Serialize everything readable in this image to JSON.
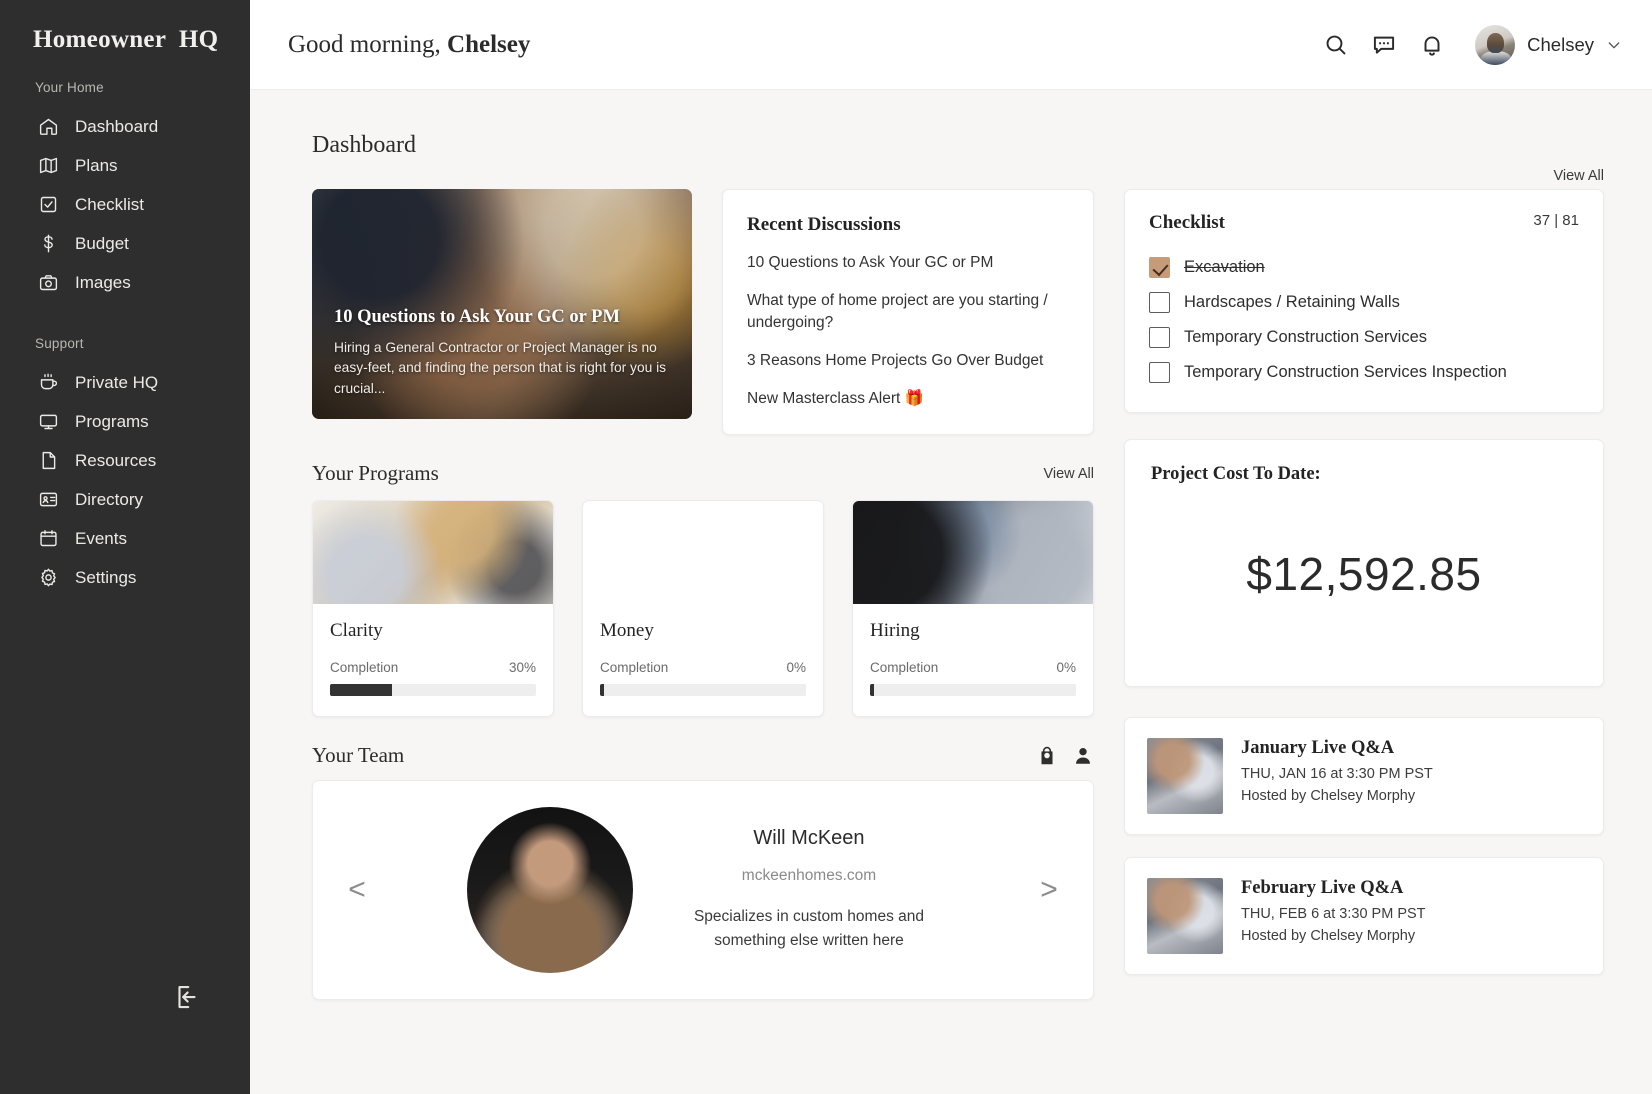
{
  "sidebar": {
    "brand": "Homeowner  HQ",
    "groups": [
      {
        "label": "Your Home",
        "items": [
          {
            "label": "Dashboard",
            "icon": "home-icon"
          },
          {
            "label": "Plans",
            "icon": "map-icon"
          },
          {
            "label": "Checklist",
            "icon": "checkbox-icon"
          },
          {
            "label": "Budget",
            "icon": "dollar-icon"
          },
          {
            "label": "Images",
            "icon": "camera-icon"
          }
        ]
      },
      {
        "label": "Support",
        "items": [
          {
            "label": "Private HQ",
            "icon": "coffee-icon"
          },
          {
            "label": "Programs",
            "icon": "monitor-icon"
          },
          {
            "label": "Resources",
            "icon": "file-icon"
          },
          {
            "label": "Directory",
            "icon": "contact-card-icon"
          },
          {
            "label": "Events",
            "icon": "calendar-icon"
          },
          {
            "label": "Settings",
            "icon": "gear-icon"
          }
        ]
      }
    ],
    "logout_icon": "logout-icon"
  },
  "topbar": {
    "greeting_prefix": "Good morning, ",
    "greeting_name": "Chelsey",
    "user_name": "Chelsey",
    "icons": [
      "search-icon",
      "chat-icon",
      "bell-icon"
    ]
  },
  "page": {
    "title": "Dashboard",
    "view_all": "View All"
  },
  "feature": {
    "title": "10 Questions to Ask Your GC or PM",
    "description": "Hiring a General Contractor or Project Manager is no easy-feet, and finding the person that is right for you is crucial..."
  },
  "discussions": {
    "title": "Recent Discussions",
    "items": [
      "10 Questions to Ask Your GC or PM",
      "What type of home project are you starting / undergoing?",
      "3 Reasons Home Projects Go Over Budget",
      "New Masterclass Alert 🎁"
    ]
  },
  "checklist": {
    "title": "Checklist",
    "count": "37 | 81",
    "accent": "#c69c78",
    "items": [
      {
        "label": "Excavation",
        "checked": true
      },
      {
        "label": "Hardscapes / Retaining Walls",
        "checked": false
      },
      {
        "label": "Temporary Construction Services",
        "checked": false
      },
      {
        "label": "Temporary Construction Services Inspection",
        "checked": false
      }
    ]
  },
  "programs": {
    "title": "Your Programs",
    "view_all": "View All",
    "completion_label": "Completion",
    "items": [
      {
        "name": "Clarity",
        "completion": "30%",
        "percent": 30
      },
      {
        "name": "Money",
        "completion": "0%",
        "percent": 2
      },
      {
        "name": "Hiring",
        "completion": "0%",
        "percent": 2
      }
    ]
  },
  "cost": {
    "label": "Project Cost To Date:",
    "value": "$12,592.85"
  },
  "team": {
    "title": "Your Team",
    "icons": [
      "shopping-bag-icon",
      "person-icon"
    ],
    "prev": "<",
    "next": ">",
    "member": {
      "name": "Will McKeen",
      "website": "mckeenhomes.com",
      "description": "Specializes in custom homes and something else written here"
    }
  },
  "events": [
    {
      "title": "January Live Q&A",
      "when": "THU, JAN 16 at 3:30 PM PST",
      "host": "Hosted by Chelsey Morphy"
    },
    {
      "title": "February Live Q&A",
      "when": "THU, FEB 6 at 3:30 PM PST",
      "host": "Hosted by Chelsey Morphy"
    }
  ]
}
